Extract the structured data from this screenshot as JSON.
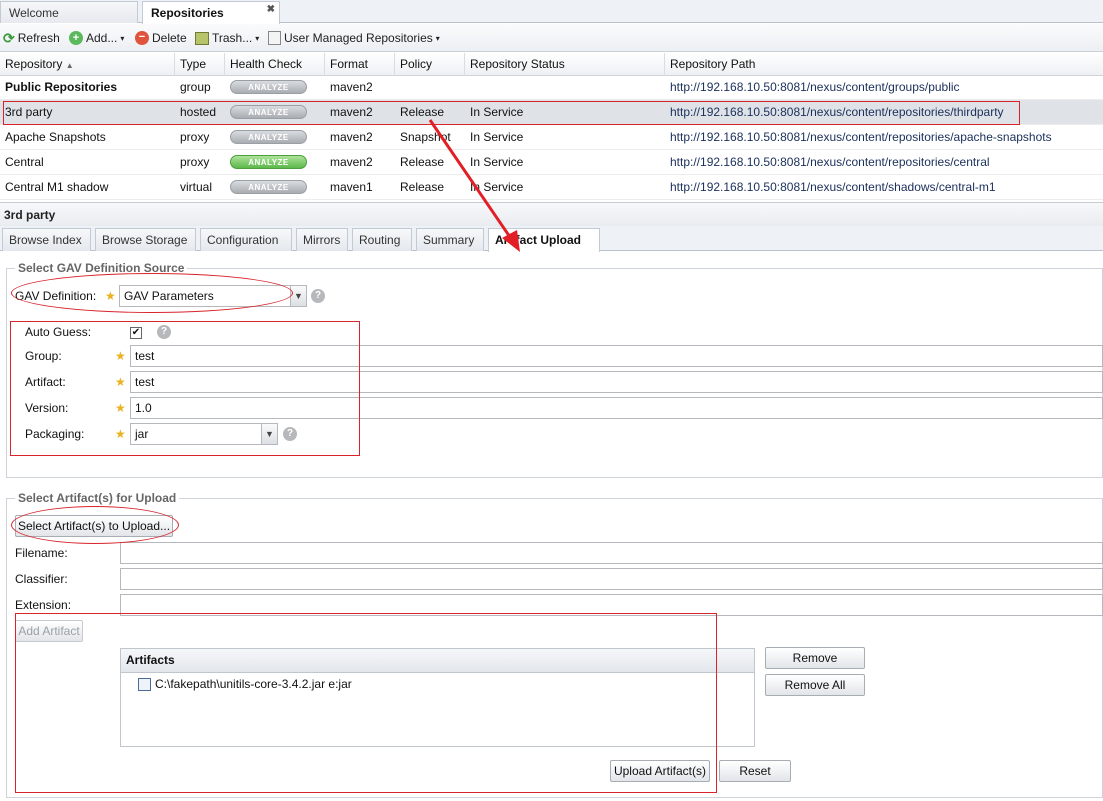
{
  "top_tabs": [
    {
      "label": "Welcome"
    },
    {
      "label": "Repositories"
    }
  ],
  "toolbar": {
    "refresh": "Refresh",
    "add": "Add...",
    "delete": "Delete",
    "trash": "Trash...",
    "user_managed": "User Managed Repositories"
  },
  "grid": {
    "columns": [
      "Repository",
      "Type",
      "Health Check",
      "Format",
      "Policy",
      "Repository Status",
      "Repository Path"
    ],
    "analyze_label": "ANALYZE",
    "rows": [
      {
        "name": "Public Repositories",
        "type": "group",
        "format": "maven2",
        "policy": "",
        "status": "",
        "path": "http://192.168.10.50:8081/nexus/content/groups/public"
      },
      {
        "name": "3rd party",
        "type": "hosted",
        "format": "maven2",
        "policy": "Release",
        "status": "In Service",
        "path": "http://192.168.10.50:8081/nexus/content/repositories/thirdparty"
      },
      {
        "name": "Apache Snapshots",
        "type": "proxy",
        "format": "maven2",
        "policy": "Snapshot",
        "status": "In Service",
        "path": "http://192.168.10.50:8081/nexus/content/repositories/apache-snapshots"
      },
      {
        "name": "Central",
        "type": "proxy",
        "format": "maven2",
        "policy": "Release",
        "status": "In Service",
        "path": "http://192.168.10.50:8081/nexus/content/repositories/central"
      },
      {
        "name": "Central M1 shadow",
        "type": "virtual",
        "format": "maven1",
        "policy": "Release",
        "status": "In Service",
        "path": "http://192.168.10.50:8081/nexus/content/shadows/central-m1"
      }
    ]
  },
  "detail": {
    "title": "3rd party",
    "tabs": [
      "Browse Index",
      "Browse Storage",
      "Configuration",
      "Mirrors",
      "Routing",
      "Summary",
      "Artifact Upload"
    ]
  },
  "gav": {
    "legend": "Select GAV Definition Source",
    "definition_label": "GAV Definition:",
    "definition_value": "GAV Parameters",
    "auto_guess_label": "Auto Guess:",
    "group_label": "Group:",
    "group_value": "test",
    "artifact_label": "Artifact:",
    "artifact_value": "test",
    "version_label": "Version:",
    "version_value": "1.0",
    "packaging_label": "Packaging:",
    "packaging_value": "jar"
  },
  "upload": {
    "legend": "Select Artifact(s) for Upload",
    "select_button": "Select Artifact(s) to Upload...",
    "filename_label": "Filename:",
    "classifier_label": "Classifier:",
    "extension_label": "Extension:",
    "add_button": "Add Artifact",
    "artifacts_header": "Artifacts",
    "artifacts": [
      "C:\\fakepath\\unitils-core-3.4.2.jar e:jar"
    ],
    "remove_button": "Remove",
    "remove_all_button": "Remove All",
    "upload_button": "Upload Artifact(s)",
    "reset_button": "Reset"
  }
}
